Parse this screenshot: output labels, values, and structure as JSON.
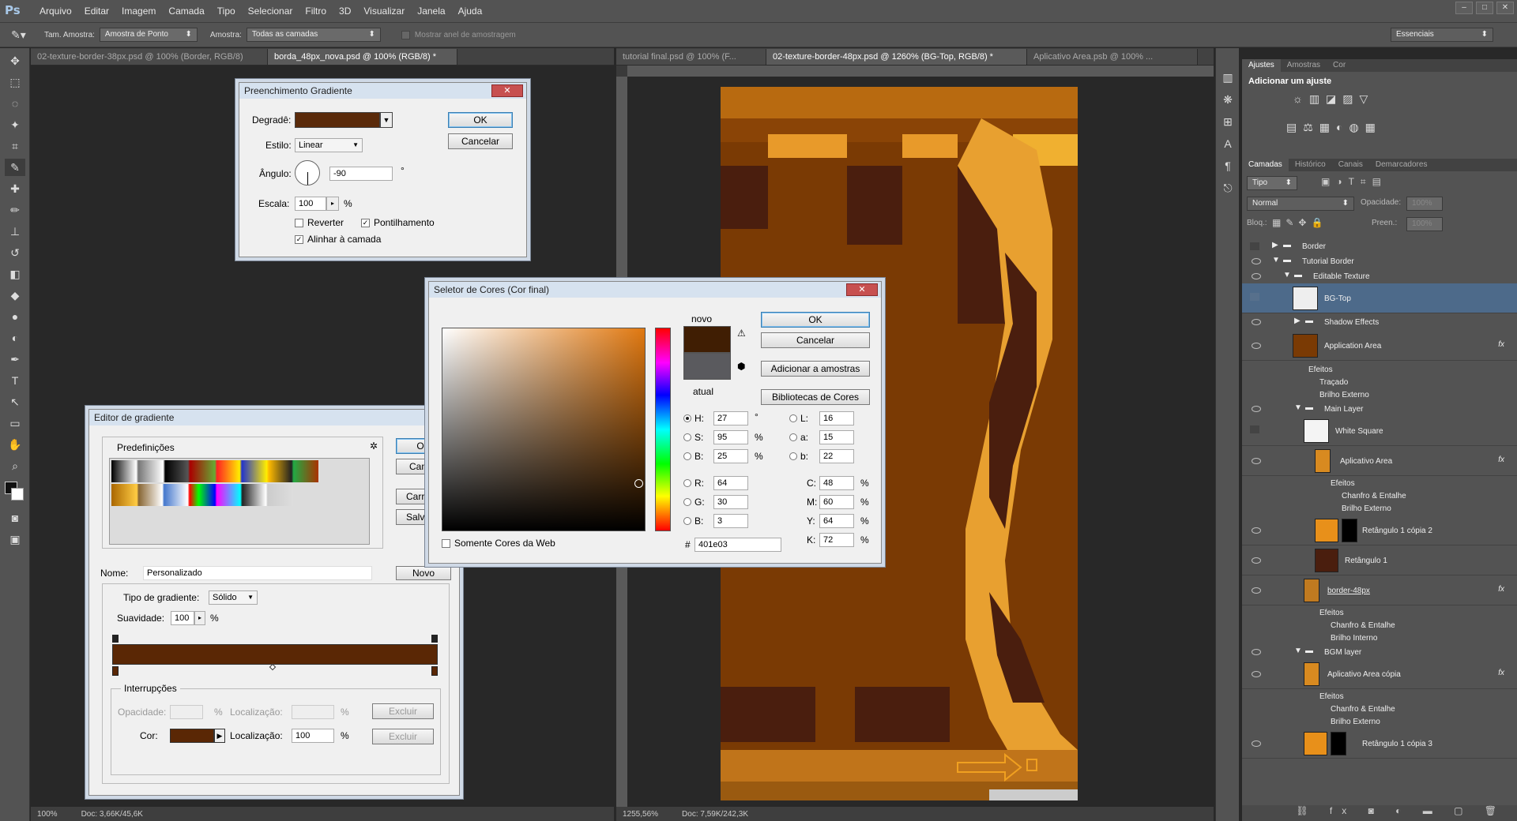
{
  "app": {
    "logo": "Ps"
  },
  "menu": [
    "Arquivo",
    "Editar",
    "Imagem",
    "Camada",
    "Tipo",
    "Selecionar",
    "Filtro",
    "3D",
    "Visualizar",
    "Janela",
    "Ajuda"
  ],
  "options": {
    "tam_label": "Tam. Amostra:",
    "tam_value": "Amostra de Ponto",
    "amostra_label": "Amostra:",
    "amostra_value": "Todas as camadas",
    "mostrar_anel": "Mostrar anel de amostragem",
    "workspace": "Essenciais"
  },
  "left_doc": {
    "tabs": [
      "02-texture-border-38px.psd @ 100% (Border, RGB/8)",
      "borda_48px_nova.psd @ 100% (RGB/8) *"
    ],
    "zoom": "100%",
    "doc_info": "Doc: 3,66K/45,6K"
  },
  "right_doc": {
    "tabs": [
      "tutorial final.psd @ 100% (F...",
      "02-texture-border-48px.psd @ 1260% (BG-Top, RGB/8) *",
      "Aplicativo Area.psb @ 100% ..."
    ],
    "zoom": "1255,56%",
    "doc_info": "Doc: 7,59K/242,3K"
  },
  "gradient_fill": {
    "title": "Preenchimento Gradiente",
    "degrade_label": "Degradê:",
    "estilo_label": "Estilo:",
    "estilo_value": "Linear",
    "angulo_label": "Ângulo:",
    "angulo_value": "-90",
    "angulo_unit": "°",
    "escala_label": "Escala:",
    "escala_value": "100",
    "escala_unit": "%",
    "reverter": "Reverter",
    "pontilhamento": "Pontilhamento",
    "alinhar": "Alinhar à camada",
    "ok": "OK",
    "cancel": "Cancelar",
    "color": "#5a2a0a"
  },
  "gradient_editor": {
    "title": "Editor de gradiente",
    "presets_label": "Predefinições",
    "ok": "OK",
    "cancel": "Cancel",
    "load": "Carrega",
    "save": "Salvar",
    "nome_label": "Nome:",
    "nome_value": "Personalizado",
    "novo": "Novo",
    "tipo_label": "Tipo de gradiente:",
    "tipo_value": "Sólido",
    "suavidade_label": "Suavidade:",
    "suavidade_value": "100",
    "suavidade_unit": "%",
    "interrupcoes": "Interrupções",
    "opacidade_label": "Opacidade:",
    "localizacao_label": "Localização:",
    "excluir": "Excluir",
    "cor_label": "Cor:",
    "loc_value": "100",
    "pct": "%",
    "bar_color": "#5a2705"
  },
  "color_picker": {
    "title": "Seletor de Cores (Cor final)",
    "ok": "OK",
    "cancel": "Cancelar",
    "add_swatch": "Adicionar a amostras",
    "libraries": "Bibliotecas de Cores",
    "novo": "novo",
    "atual": "atual",
    "new_color": "#401e03",
    "current_color": "#5a5a5e",
    "web_only": "Somente Cores da Web",
    "fields": {
      "H": "27",
      "S": "95",
      "Bv": "25",
      "R": "64",
      "G": "30",
      "Bb": "3",
      "L": "16",
      "a": "15",
      "b": "22",
      "C": "48",
      "M": "60",
      "Y": "64",
      "K": "72"
    },
    "units": {
      "deg": "°",
      "pct": "%"
    },
    "hex_label": "#",
    "hex": "401e03"
  },
  "panels": {
    "adjust_tabs": [
      "Ajustes",
      "Amostras",
      "Cor"
    ],
    "adjust_title": "Adicionar um ajuste",
    "layer_tabs": [
      "Camadas",
      "Histórico",
      "Canais",
      "Demarcadores"
    ],
    "kind": "Tipo",
    "blend": "Normal",
    "opacity_label": "Opacidade:",
    "opacity_value": "100%",
    "lock_label": "Bloq.:",
    "fill_label": "Preen.:",
    "fill_value": "100%",
    "layers": [
      {
        "name": "Border",
        "kind": "group"
      },
      {
        "name": "Tutorial Border",
        "kind": "group"
      },
      {
        "name": "Editable Texture",
        "kind": "group"
      },
      {
        "name": "BG-Top",
        "kind": "layer"
      },
      {
        "name": "Shadow Effects",
        "kind": "group"
      },
      {
        "name": "Application Area",
        "kind": "layer",
        "fx": "fx"
      },
      {
        "name": "Efeitos",
        "kind": "fx"
      },
      {
        "name": "Traçado",
        "kind": "fx"
      },
      {
        "name": "Brilho Externo",
        "kind": "fx"
      },
      {
        "name": "Main Layer",
        "kind": "group"
      },
      {
        "name": "White Square",
        "kind": "layer"
      },
      {
        "name": "Aplicativo Area",
        "kind": "layer",
        "fx": "fx"
      },
      {
        "name": "Efeitos",
        "kind": "fx"
      },
      {
        "name": "Chanfro & Entalhe",
        "kind": "fx"
      },
      {
        "name": "Brilho Externo",
        "kind": "fx"
      },
      {
        "name": "Retângulo 1 cópia 2",
        "kind": "layer"
      },
      {
        "name": "Retângulo 1",
        "kind": "layer"
      },
      {
        "name": "border-48px",
        "kind": "layer",
        "fx": "fx"
      },
      {
        "name": "Efeitos",
        "kind": "fx"
      },
      {
        "name": "Chanfro & Entalhe",
        "kind": "fx"
      },
      {
        "name": "Brilho Interno",
        "kind": "fx"
      },
      {
        "name": "BGM layer",
        "kind": "group"
      },
      {
        "name": "Aplicativo Area cópia",
        "kind": "layer",
        "fx": "fx"
      },
      {
        "name": "Efeitos",
        "kind": "fx"
      },
      {
        "name": "Chanfro & Entalhe",
        "kind": "fx"
      },
      {
        "name": "Brilho Externo",
        "kind": "fx"
      },
      {
        "name": "Retângulo 1 cópia 3",
        "kind": "layer"
      }
    ]
  }
}
